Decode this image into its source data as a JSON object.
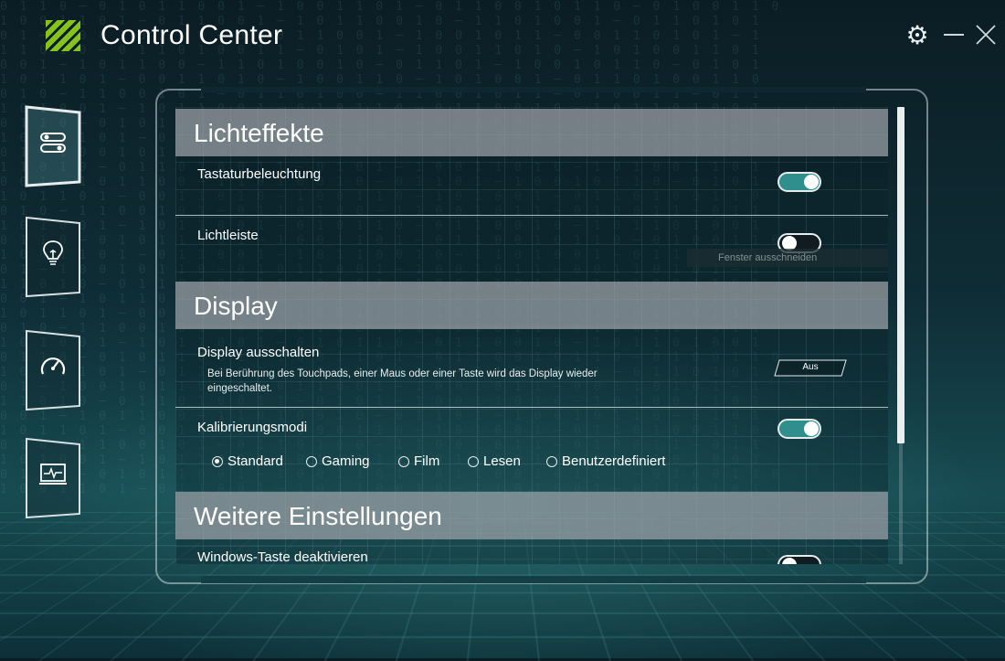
{
  "app": {
    "title": "Control Center",
    "accent": "#86c21b"
  },
  "window_controls": {
    "settings_icon": "gear-icon",
    "minimize_icon": "minimize-icon",
    "close_icon": "close-icon"
  },
  "sidebar": {
    "items": [
      {
        "icon": "toggles-icon",
        "active": true
      },
      {
        "icon": "lightbulb-icon",
        "active": false
      },
      {
        "icon": "speedometer-icon",
        "active": false
      },
      {
        "icon": "monitor-pulse-icon",
        "active": false
      }
    ]
  },
  "sections": {
    "light_effects": {
      "title": "Lichteffekte",
      "keyboard_backlight": {
        "label": "Tastaturbeleuchtung",
        "enabled": true
      },
      "light_bar": {
        "label": "Lichtleiste",
        "enabled": false
      }
    },
    "display": {
      "title": "Display",
      "display_off": {
        "label": "Display ausschalten",
        "description_line1": "Bei Berührung des Touchpads, einer Maus oder einer Taste wird das Display wieder",
        "description_line2": "eingeschaltet.",
        "button_label": "Aus"
      },
      "calibration": {
        "label": "Kalibrierungsmodi",
        "enabled": true,
        "selected": "Standard",
        "options": [
          "Standard",
          "Gaming",
          "Film",
          "Lesen",
          "Benutzerdefiniert"
        ]
      }
    },
    "more_settings": {
      "title": "Weitere Einstellungen",
      "windows_key": {
        "label": "Windows-Taste deaktivieren",
        "enabled": false
      }
    }
  },
  "tooltip": {
    "text": "Fenster ausschneiden"
  },
  "colors": {
    "toggle_on": "#2f8f8c",
    "section_header": "#a0a5aa"
  }
}
